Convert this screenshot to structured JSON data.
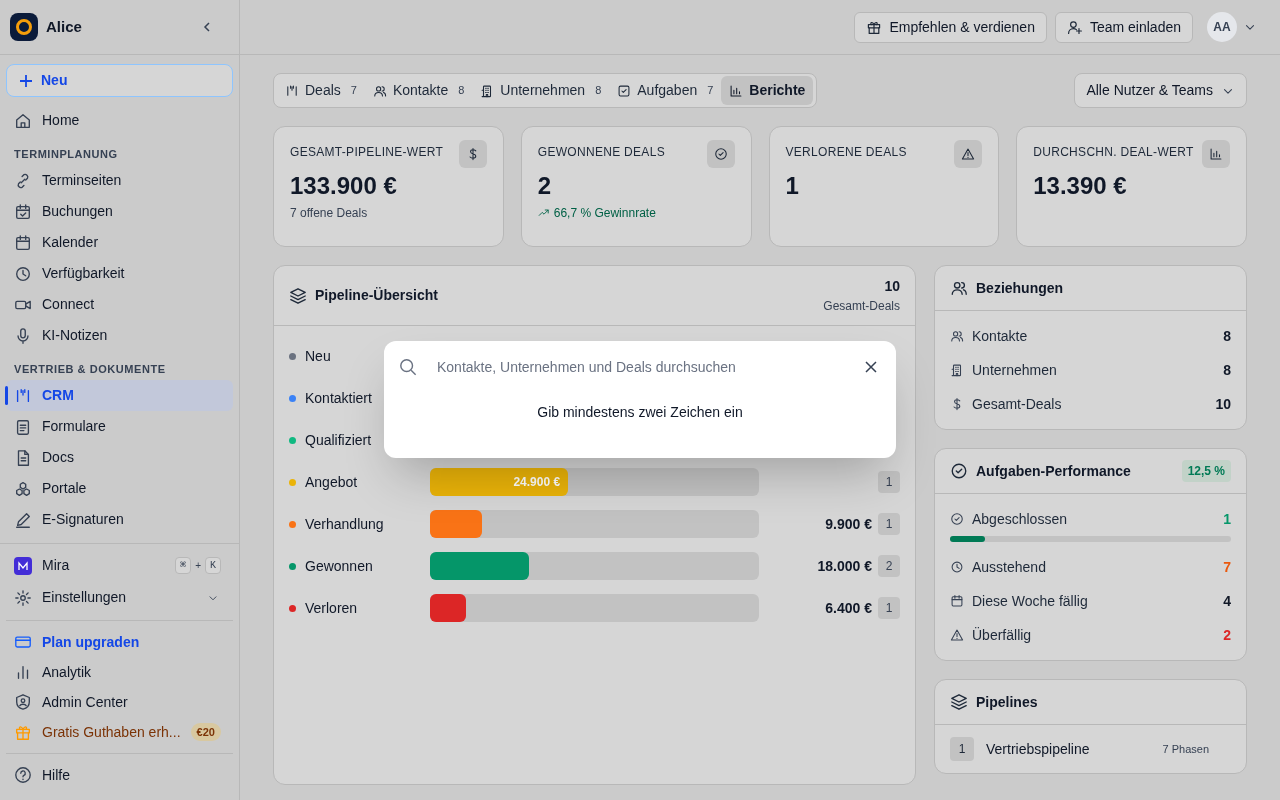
{
  "sidebar": {
    "workspace": "Alice",
    "new_button": "Neu",
    "home": {
      "label": "Home",
      "selected": false
    },
    "sections": [
      {
        "title": "TERMINPLANUNG",
        "items": [
          {
            "label": "Terminseiten",
            "selected": false
          },
          {
            "label": "Buchungen",
            "selected": false
          },
          {
            "label": "Kalender",
            "selected": false
          },
          {
            "label": "Verfügbarkeit",
            "selected": false
          },
          {
            "label": "Connect",
            "selected": false
          },
          {
            "label": "KI-Notizen",
            "selected": false
          }
        ]
      },
      {
        "title": "VERTRIEB & DOKUMENTE",
        "items": [
          {
            "label": "CRM",
            "selected": true
          },
          {
            "label": "Formulare",
            "selected": false
          },
          {
            "label": "Docs",
            "selected": false
          },
          {
            "label": "Portale",
            "selected": false
          },
          {
            "label": "E-Signaturen",
            "selected": false
          }
        ]
      }
    ],
    "assistant": {
      "label": "Mira",
      "keys": [
        "⌘",
        "K"
      ],
      "separator": "+"
    },
    "settings": {
      "label": "Einstellungen"
    },
    "footer_items": [
      {
        "kind": "upgrade",
        "label": "Plan upgraden"
      },
      {
        "kind": "link",
        "label": "Analytik"
      },
      {
        "kind": "link",
        "label": "Admin Center"
      },
      {
        "kind": "promo",
        "label": "Gratis Guthaben erh...",
        "badge": "€20"
      }
    ],
    "help": {
      "label": "Hilfe"
    }
  },
  "header": {
    "buttons": [
      "Empfehlen & verdienen",
      "Team einladen"
    ],
    "avatar": "AA"
  },
  "tabs": [
    {
      "label": "Deals",
      "count": "7",
      "selected": false
    },
    {
      "label": "Kontakte",
      "count": "8",
      "selected": false
    },
    {
      "label": "Unternehmen",
      "count": "8",
      "selected": false
    },
    {
      "label": "Aufgaben",
      "count": "7",
      "selected": false
    },
    {
      "label": "Berichte",
      "selected": true
    }
  ],
  "filter": "Alle Nutzer & Teams",
  "stats": [
    {
      "label": "GESAMT-PIPELINE-WERT",
      "value": "133.900 €",
      "sub": "7 offene Deals",
      "kind": "plain"
    },
    {
      "label": "GEWONNENE DEALS",
      "value": "2",
      "sub": "66,7 % Gewinnrate",
      "kind": "trend"
    },
    {
      "label": "VERLORENE DEALS",
      "value": "1"
    },
    {
      "label": "DURCHSCHN. DEAL-WERT",
      "value": "13.390 €"
    }
  ],
  "pipeline": {
    "title": "Pipeline-Übersicht",
    "total": "10",
    "total_label": "Gesamt-Deals",
    "stages": [
      {
        "name": "Neu",
        "color": "#6b7280"
      },
      {
        "name": "Kontaktiert",
        "color": "#3b82f6"
      },
      {
        "name": "Qualifiziert",
        "color": "#10b981"
      },
      {
        "name": "Angebot",
        "color": "#eab308",
        "level": 0.42,
        "value": "24.900 €",
        "value_inside": true,
        "count": "1"
      },
      {
        "name": "Verhandlung",
        "color": "#f97316",
        "level": 0.16,
        "value": "9.900 €",
        "value_inside": false,
        "count": "1"
      },
      {
        "name": "Gewonnen",
        "color": "#059669",
        "level": 0.3,
        "value": "18.000 €",
        "value_inside": false,
        "count": "2"
      },
      {
        "name": "Verloren",
        "color": "#dc2626",
        "level": 0.11,
        "value": "6.400 €",
        "value_inside": false,
        "count": "1"
      }
    ]
  },
  "relations": {
    "title": "Beziehungen",
    "rows": [
      {
        "label": "Kontakte",
        "value": "8"
      },
      {
        "label": "Unternehmen",
        "value": "8"
      },
      {
        "label": "Gesamt-Deals",
        "value": "10"
      }
    ]
  },
  "tasks": {
    "title": "Aufgaben-Performance",
    "badge": "12,5 %",
    "level": 0.125,
    "rows": [
      {
        "label": "Abgeschlossen",
        "value": "1",
        "color": "#059669"
      },
      {
        "label": "Ausstehend",
        "value": "7",
        "color": "#ea580c"
      },
      {
        "label": "Diese Woche fällig",
        "value": "4",
        "color": "#111827"
      },
      {
        "label": "Überfällig",
        "value": "2",
        "color": "#dc2626"
      }
    ]
  },
  "pipelines": {
    "title": "Pipelines",
    "items": [
      {
        "index": "1",
        "name": "Vertriebspipeline",
        "phases": "7 Phasen"
      }
    ]
  },
  "search": {
    "placeholder": "Kontakte, Unternehmen und Deals durchsuchen",
    "message": "Gib mindestens zwei Zeichen ein"
  }
}
